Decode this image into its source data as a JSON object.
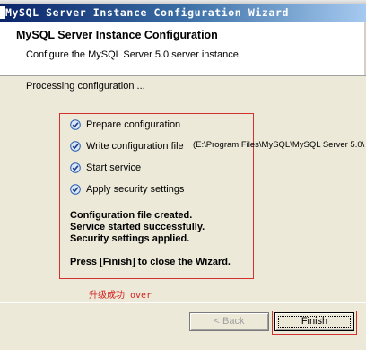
{
  "window": {
    "title": "MySQL Server Instance Configuration Wizard"
  },
  "header": {
    "title": "MySQL Server Instance Configuration",
    "subtitle": "Configure the MySQL Server 5.0 server instance."
  },
  "main": {
    "status": "Processing configuration ...",
    "steps": [
      {
        "label": "Prepare configuration",
        "checked": true
      },
      {
        "label": "Write configuration file",
        "detail": "(E:\\Program Files\\MySQL\\MySQL Server 5.0\\",
        "checked": true
      },
      {
        "label": "Start service",
        "checked": true
      },
      {
        "label": "Apply security settings",
        "checked": true
      }
    ],
    "summary_lines": [
      "Configuration file created.",
      "Service started successfully.",
      "Security settings applied."
    ],
    "instruction": "Press [Finish] to close the Wizard."
  },
  "annotation": {
    "chinese": "升级成功",
    "english": "over",
    "color": "#d42020"
  },
  "footer": {
    "back_label": "< Back",
    "finish_label": "Finish"
  },
  "colors": {
    "titlebar_start": "#0a246a",
    "titlebar_end": "#a6caf0",
    "dialog_bg": "#ece9d8",
    "highlight_border": "#d43030",
    "check_icon": "#2a5fb0"
  },
  "icons": {
    "step_check": "checkmark-circle-icon"
  }
}
